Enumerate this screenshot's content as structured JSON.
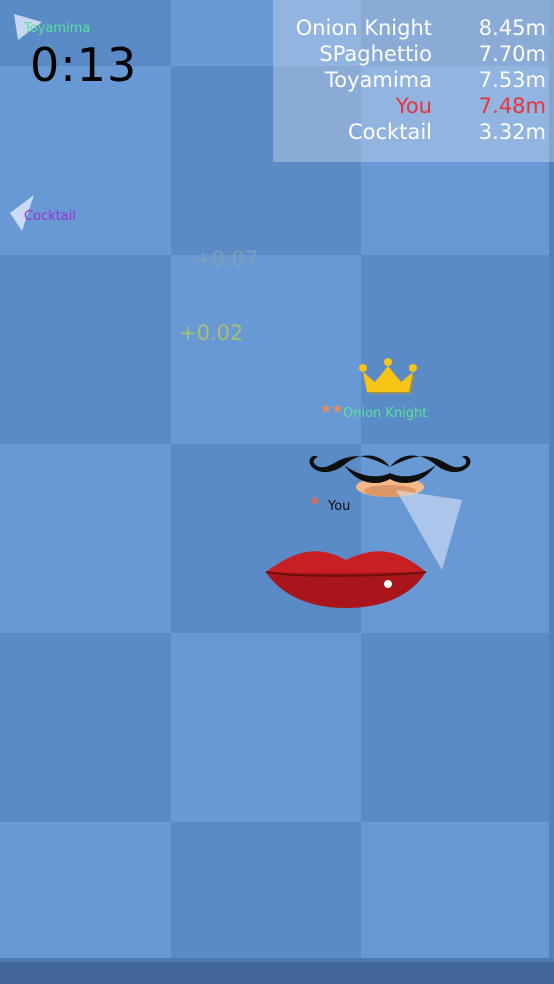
{
  "timer": "0:13",
  "leaderboard": [
    {
      "name": "Onion Knight",
      "score": "8.45m",
      "me": false
    },
    {
      "name": "SPaghettio",
      "score": "7.70m",
      "me": false
    },
    {
      "name": "Toyamima",
      "score": "7.53m",
      "me": false
    },
    {
      "name": "You",
      "score": "7.48m",
      "me": true
    },
    {
      "name": "Cocktail",
      "score": "3.32m",
      "me": false
    }
  ],
  "float_texts": {
    "a": "+0.07",
    "b": "+0.02"
  },
  "players": {
    "toyamima": "Toyamima",
    "cocktail": "Cocktail",
    "onion_knight": "Onion Knight",
    "you": "You"
  },
  "ranks": {
    "onion_knight": "★★",
    "you": "★"
  },
  "icons": [
    "crown-icon",
    "mustache-icon",
    "lips-icon",
    "direction-arrow-icon",
    "star-icon"
  ],
  "colors": {
    "you": "#e8343a",
    "cocktail": "#9b30d9",
    "onion_knight": "#56e39a",
    "crown": "#f6c415",
    "lips": "#b8161c"
  }
}
